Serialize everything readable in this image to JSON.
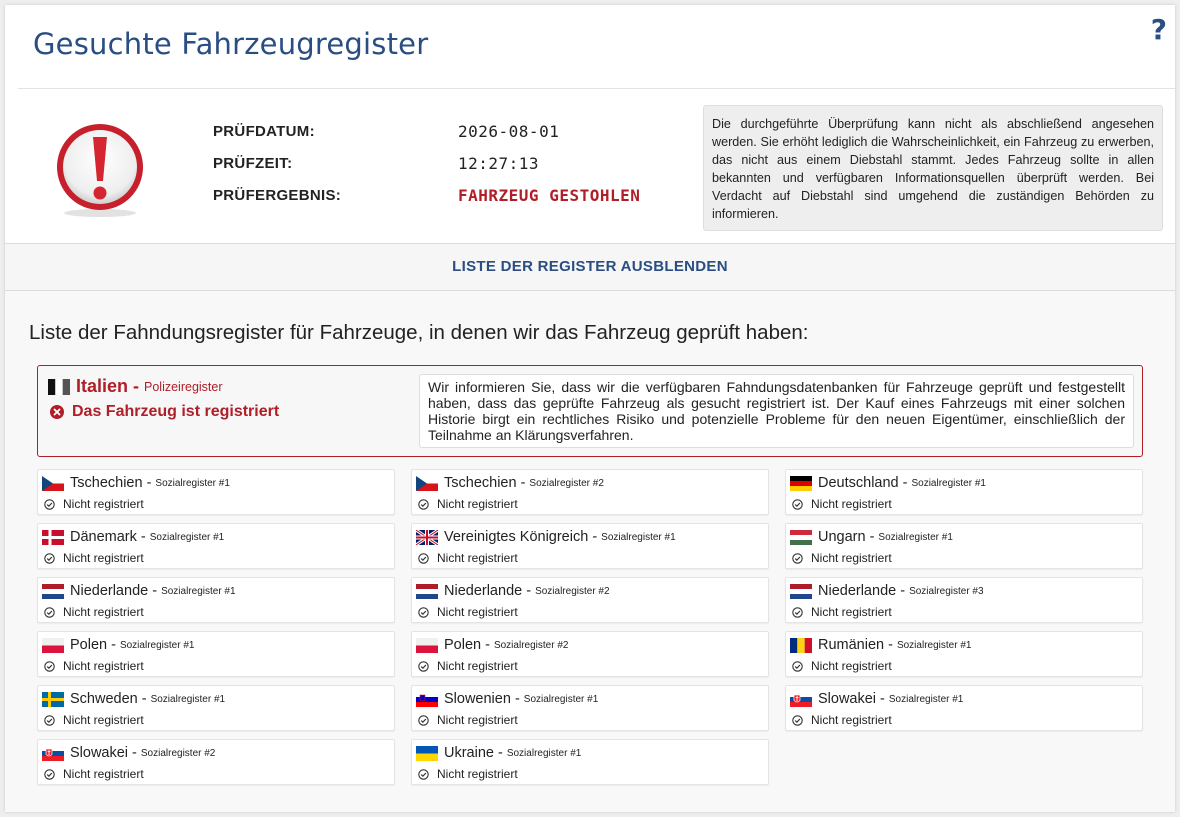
{
  "header": {
    "title": "Gesuchte Fahrzeugregister",
    "help": "?"
  },
  "check": {
    "date_label": "PRÜFDATUM:",
    "date_value": "2026-08-01",
    "time_label": "PRÜFZEIT:",
    "time_value": "12:27:13",
    "result_label": "PRÜFERGEBNIS:",
    "result_value": "FAHRZEUG GESTOHLEN"
  },
  "disclaimer": "Die durchgeführte Überprüfung kann nicht als abschließend angesehen werden. Sie erhöht lediglich die Wahrscheinlichkeit, ein Fahrzeug zu erwerben, das nicht aus einem Diebstahl stammt. Jedes Fahrzeug sollte in allen bekannten und verfügbaren Informationsquellen überprüft werden. Bei Verdacht auf Diebstahl sind umgehend die zuständigen Behörden zu informieren.",
  "toggle_label": "LISTE DER REGISTER AUSBLENDEN",
  "list_heading": "Liste der Fahndungsregister für Fahrzeuge, in denen wir das Fahrzeug geprüft haben:",
  "stolen": {
    "country": "Italien",
    "sep": " - ",
    "register": "Polizeiregister",
    "status": "Das Fahrzeug ist registriert",
    "message": "Wir informieren Sie, dass wir die verfügbaren Fahndungsdatenbanken für Fahrzeuge geprüft und festgestellt haben, dass das geprüfte Fahrzeug als gesucht registriert ist. Der Kauf eines Fahrzeugs mit einer solchen Historie birgt ein rechtliches Risiko und potenzielle Probleme für den neuen Eigentümer, einschließlich der Teilnahme an Klärungsverfahren."
  },
  "registers": [
    {
      "country": "Tschechien",
      "register": "Sozialregister #1",
      "status": "Nicht registriert",
      "flag": "cz"
    },
    {
      "country": "Tschechien",
      "register": "Sozialregister #2",
      "status": "Nicht registriert",
      "flag": "cz"
    },
    {
      "country": "Deutschland",
      "register": "Sozialregister #1",
      "status": "Nicht registriert",
      "flag": "de"
    },
    {
      "country": "Dänemark",
      "register": "Sozialregister #1",
      "status": "Nicht registriert",
      "flag": "dk"
    },
    {
      "country": "Vereinigtes Königreich",
      "register": "Sozialregister #1",
      "status": "Nicht registriert",
      "flag": "gb"
    },
    {
      "country": "Ungarn",
      "register": "Sozialregister #1",
      "status": "Nicht registriert",
      "flag": "hu"
    },
    {
      "country": "Niederlande",
      "register": "Sozialregister #1",
      "status": "Nicht registriert",
      "flag": "nl"
    },
    {
      "country": "Niederlande",
      "register": "Sozialregister #2",
      "status": "Nicht registriert",
      "flag": "nl"
    },
    {
      "country": "Niederlande",
      "register": "Sozialregister #3",
      "status": "Nicht registriert",
      "flag": "nl"
    },
    {
      "country": "Polen",
      "register": "Sozialregister #1",
      "status": "Nicht registriert",
      "flag": "pl"
    },
    {
      "country": "Polen",
      "register": "Sozialregister #2",
      "status": "Nicht registriert",
      "flag": "pl"
    },
    {
      "country": "Rumänien",
      "register": "Sozialregister #1",
      "status": "Nicht registriert",
      "flag": "ro"
    },
    {
      "country": "Schweden",
      "register": "Sozialregister #1",
      "status": "Nicht registriert",
      "flag": "se"
    },
    {
      "country": "Slowenien",
      "register": "Sozialregister #1",
      "status": "Nicht registriert",
      "flag": "si"
    },
    {
      "country": "Slowakei",
      "register": "Sozialregister #1",
      "status": "Nicht registriert",
      "flag": "sk"
    },
    {
      "country": "Slowakei",
      "register": "Sozialregister #2",
      "status": "Nicht registriert",
      "flag": "sk"
    },
    {
      "country": "Ukraine",
      "register": "Sozialregister #1",
      "status": "Nicht registriert",
      "flag": "ua"
    }
  ],
  "colors": {
    "accent": "#2a4d82",
    "danger": "#b01e28"
  }
}
